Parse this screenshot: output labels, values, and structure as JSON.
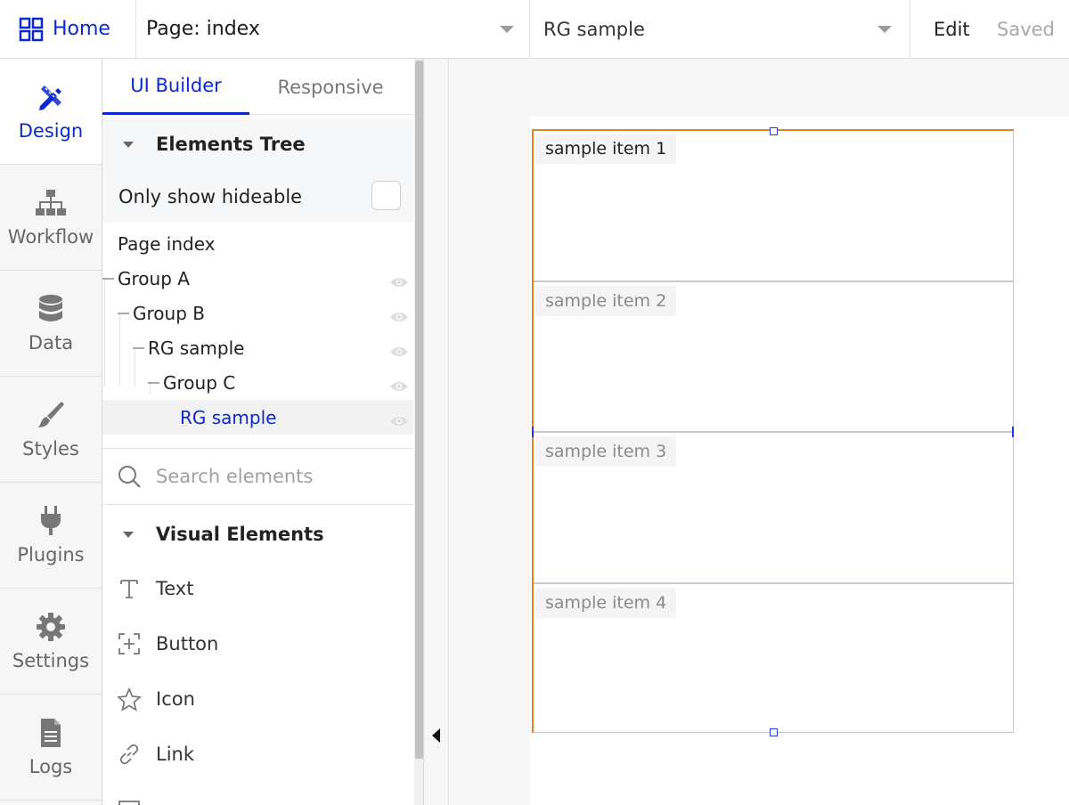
{
  "topbar": {
    "home_label": "Home",
    "page_label": "Page: index",
    "element_label": "RG sample",
    "edit_label": "Edit",
    "saved_label": "Saved"
  },
  "nav": {
    "items": [
      {
        "label": "Design",
        "icon": "design-icon",
        "active": true
      },
      {
        "label": "Workflow",
        "icon": "workflow-icon",
        "active": false
      },
      {
        "label": "Data",
        "icon": "database-icon",
        "active": false
      },
      {
        "label": "Styles",
        "icon": "brush-icon",
        "active": false
      },
      {
        "label": "Plugins",
        "icon": "plug-icon",
        "active": false
      },
      {
        "label": "Settings",
        "icon": "gear-icon",
        "active": false
      },
      {
        "label": "Logs",
        "icon": "document-icon",
        "active": false
      }
    ]
  },
  "panel": {
    "tabs": [
      {
        "label": "UI Builder",
        "active": true
      },
      {
        "label": "Responsive",
        "active": false
      }
    ],
    "tree_title": "Elements Tree",
    "hideable_label": "Only show hideable",
    "tree": [
      {
        "label": "Page index"
      },
      {
        "label": "Group A"
      },
      {
        "label": "Group B"
      },
      {
        "label": "RG sample"
      },
      {
        "label": "Group C"
      },
      {
        "label": "RG sample"
      }
    ],
    "search_placeholder": "Search elements",
    "visual_title": "Visual Elements",
    "visual_items": [
      {
        "label": "Text",
        "icon": "text-icon"
      },
      {
        "label": "Button",
        "icon": "button-icon"
      },
      {
        "label": "Icon",
        "icon": "star-icon"
      },
      {
        "label": "Link",
        "icon": "link-icon"
      }
    ]
  },
  "canvas": {
    "cells": [
      {
        "label": "sample item 1"
      },
      {
        "label": "sample item 2"
      },
      {
        "label": "sample item 3"
      },
      {
        "label": "sample item 4"
      }
    ]
  },
  "colors": {
    "accent": "#0c29d0",
    "selection_edge": "#e0822c",
    "nav_bg": "#f6f6f7"
  }
}
